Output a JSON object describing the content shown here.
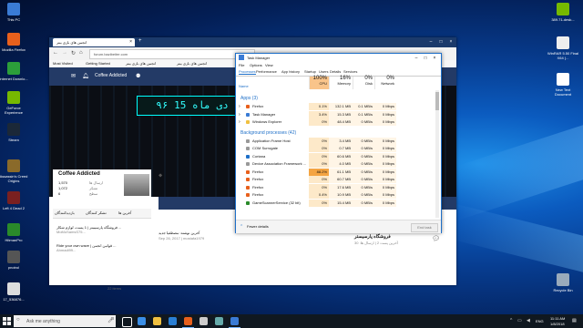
{
  "desktop": {
    "left_icons": [
      {
        "label": "This PC",
        "color": "#3a7bd5"
      },
      {
        "label": "Mozilla Firefox",
        "color": "#e8601c"
      },
      {
        "label": "Internet Downlo...",
        "color": "#2c9e3a"
      },
      {
        "label": "GeForce Experience",
        "color": "#76b900"
      },
      {
        "label": "Steam",
        "color": "#1b2838"
      },
      {
        "label": "Assassin's Creed Origins",
        "color": "#8a6a2a"
      },
      {
        "label": "Left 4 Dead 2",
        "color": "#7a2020"
      },
      {
        "label": "HitmanPro",
        "color": "#2a8a2a"
      },
      {
        "label": "pnotrol",
        "color": "#555"
      },
      {
        "label": "17_536876...",
        "color": "#ddd"
      }
    ],
    "right_icons": [
      {
        "label": "389.71-desk...",
        "color": "#76b900"
      },
      {
        "label": "WinRAR 5.50 Final X64 (...",
        "color": "#eee"
      },
      {
        "label": "New Text Document",
        "color": "#fff"
      },
      {
        "label": "Recycle Bin",
        "color": "#9ab"
      }
    ]
  },
  "taskbar": {
    "search_placeholder": "Ask me anything",
    "lang": "ENG",
    "time": "11:11 AM",
    "date": "1/8/2018",
    "apps": [
      "task-view",
      "edge",
      "file-explorer",
      "store",
      "firefox",
      "gear",
      "monitor",
      "task-manager"
    ]
  },
  "browser": {
    "tab_title": "انجمن های بازی بیتر",
    "url": "forum.bazibeiter.com",
    "bookmarks": [
      "Most Visited",
      "Getting Started",
      "انجمن های بازی بیتر",
      "انجمن های بازی بیتر"
    ],
    "header_user": "Coffee Addicted",
    "led_text": "۹۶ دی ماه 15",
    "profile": {
      "name": "Coffee Addicted",
      "stat1": "1,570",
      "stat2": "1,072",
      "stat3": "6",
      "label1": "ارسال ها",
      "label2": "تشکر",
      "label3": "سطح"
    },
    "tabs": [
      "آخرین ها",
      "تشکر کنندگان",
      "بازدیدکنندگان"
    ],
    "posts": [
      {
        "text": "فروشگاه پارسیبیتر | 1 پست، لوازم شکار ...",
        "meta": "MoMoSamsS75..."
      },
      {
        "text": "Ride your own wave | قوانین انجمن ...",
        "meta": "Ahmadi99..."
      }
    ],
    "thread_title": "آخرین نوشته: مصطفیا جدید",
    "thread_meta": "Sep 26, 2017 | mostafa1979",
    "thread2": "فروشگاه پارسیستر",
    "thread2_meta": "آخرین پست 2 | ارسال ها: 30",
    "footer_count": "22 items"
  },
  "task_manager": {
    "title": "Task Manager",
    "menu": [
      "File",
      "Options",
      "View"
    ],
    "tabs": [
      "Processes",
      "Performance",
      "App history",
      "Startup",
      "Users",
      "Details",
      "Services"
    ],
    "columns": [
      {
        "pct": "100%",
        "label": "CPU"
      },
      {
        "pct": "16%",
        "label": "Memory"
      },
      {
        "pct": "0%",
        "label": "Disk"
      },
      {
        "pct": "0%",
        "label": "Network"
      }
    ],
    "col_name": "Name",
    "apps_group": "Apps (3)",
    "apps": [
      {
        "name": "Firefox",
        "cpu": "0.1%",
        "mem": "132.1 MB",
        "disk": "0.1 MB/s",
        "net": "0 Mbps",
        "color": "#e8601c"
      },
      {
        "name": "Task Manager",
        "cpu": "3.4%",
        "mem": "15.3 MB",
        "disk": "0.1 MB/s",
        "net": "0 Mbps",
        "color": "#3a7bd5"
      },
      {
        "name": "Windows Explorer",
        "cpu": "0%",
        "mem": "48.4 MB",
        "disk": "0 MB/s",
        "net": "0 Mbps",
        "color": "#f0c040"
      }
    ],
    "bg_group": "Background processes (42)",
    "bg": [
      {
        "name": "Application Frame Host",
        "cpu": "0%",
        "mem": "3.4 MB",
        "disk": "0 MB/s",
        "net": "0 Mbps",
        "color": "#999"
      },
      {
        "name": "COM Surrogate",
        "cpu": "0%",
        "mem": "0.7 MB",
        "disk": "0 MB/s",
        "net": "0 Mbps",
        "color": "#999"
      },
      {
        "name": "Cortana",
        "cpu": "0%",
        "mem": "60.6 MB",
        "disk": "0 MB/s",
        "net": "0 Mbps",
        "color": "#1e6fc8"
      },
      {
        "name": "Device Association Framework ...",
        "cpu": "0%",
        "mem": "4.0 MB",
        "disk": "0 MB/s",
        "net": "0 Mbps",
        "color": "#999"
      },
      {
        "name": "Firefox",
        "cpu": "88.2%",
        "mem": "61.1 MB",
        "disk": "0 MB/s",
        "net": "0 Mbps",
        "color": "#e8601c"
      },
      {
        "name": "Firefox",
        "cpu": "0%",
        "mem": "60.7 MB",
        "disk": "0 MB/s",
        "net": "0 Mbps",
        "color": "#e8601c"
      },
      {
        "name": "Firefox",
        "cpu": "0%",
        "mem": "17.6 MB",
        "disk": "0 MB/s",
        "net": "0 Mbps",
        "color": "#e8601c"
      },
      {
        "name": "Firefox",
        "cpu": "0.4%",
        "mem": "10.9 MB",
        "disk": "0 MB/s",
        "net": "0 Mbps",
        "color": "#e8601c"
      },
      {
        "name": "GameScannerService (32 bit)",
        "cpu": "0%",
        "mem": "15.4 MB",
        "disk": "0 MB/s",
        "net": "0 Mbps",
        "color": "#2a8a2a"
      }
    ],
    "fewer_details": "Fewer details",
    "end_task": "End task"
  }
}
